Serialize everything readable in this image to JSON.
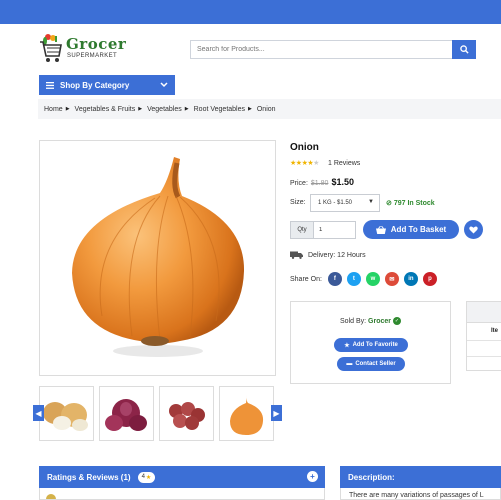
{
  "header": {
    "logo_title": "Grocer",
    "logo_subtitle": "SUPERMARKET",
    "search_placeholder": "Search for Products...",
    "category_button": "Shop By Category"
  },
  "breadcrumb": [
    "Home",
    "Vegetables & Fruits",
    "Vegetables",
    "Root Vegetables",
    "Onion"
  ],
  "product": {
    "title": "Onion",
    "rating": 4,
    "reviews_text": "1 Reviews",
    "price_label": "Price:",
    "old_price": "$1.80",
    "price": "$1.50",
    "size_label": "Size:",
    "size_selected": "1 KG - $1.50",
    "stock": "797 In Stock",
    "qty_label": "Qty",
    "qty_value": "1",
    "basket_button": "Add To Basket",
    "delivery": "Delivery: 12 Hours",
    "share_label": "Share On:"
  },
  "social": [
    {
      "name": "facebook",
      "glyph": "f",
      "color": "#3b5998"
    },
    {
      "name": "twitter",
      "glyph": "t",
      "color": "#1da1f2"
    },
    {
      "name": "whatsapp",
      "glyph": "w",
      "color": "#25d366"
    },
    {
      "name": "email",
      "glyph": "✉",
      "color": "#dd4b39"
    },
    {
      "name": "linkedin",
      "glyph": "in",
      "color": "#0077b5"
    },
    {
      "name": "pinterest",
      "glyph": "p",
      "color": "#cb2027"
    }
  ],
  "seller": {
    "sold_by_label": "Sold By:",
    "seller_name": "Grocer",
    "favorite_button": "Add To Favorite",
    "contact_button": "Contact Seller"
  },
  "specs": {
    "header_partial": "Ite"
  },
  "thumbnails": [
    "white onions",
    "red onions",
    "shallots",
    "onion"
  ],
  "ratings_panel": {
    "title": "Ratings & Reviews (1)",
    "average": "4"
  },
  "description_panel": {
    "title": "Description:",
    "text_partial": "There are many variations of passages of L"
  },
  "colors": {
    "accent": "#3c6fd6",
    "green": "#2f7a2f",
    "star": "#f0b400"
  }
}
